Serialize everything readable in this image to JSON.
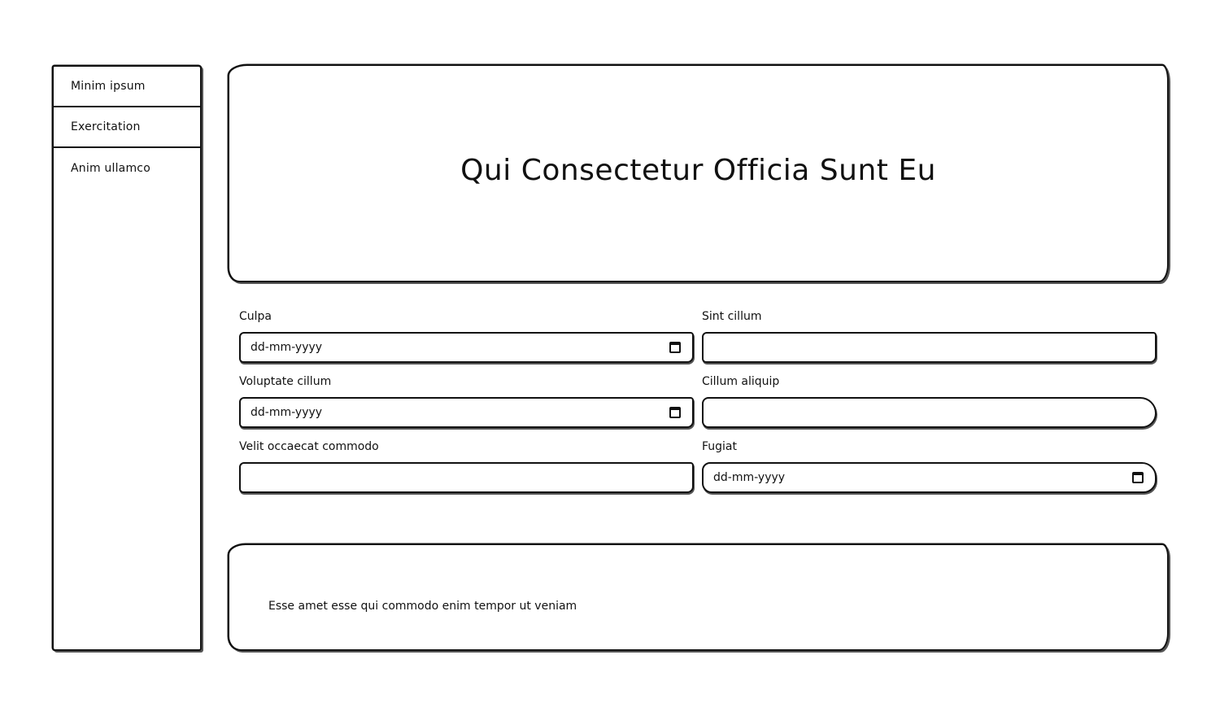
{
  "sidebar": {
    "items": [
      {
        "label": "Minim ipsum"
      },
      {
        "label": "Exercitation"
      },
      {
        "label": "Anim ullamco"
      }
    ]
  },
  "header": {
    "title": "Qui Consectetur Officia Sunt Eu"
  },
  "form": {
    "fields": [
      {
        "label": "Culpa",
        "type": "date",
        "value": "dd-mm-yyyy"
      },
      {
        "label": "Sint cillum",
        "type": "text",
        "value": ""
      },
      {
        "label": "Voluptate cillum",
        "type": "date",
        "value": "dd-mm-yyyy"
      },
      {
        "label": "Cillum aliquip",
        "type": "text",
        "value": ""
      },
      {
        "label": "Velit occaecat commodo",
        "type": "text",
        "value": ""
      },
      {
        "label": "Fugiat",
        "type": "date",
        "value": "dd-mm-yyyy"
      }
    ]
  },
  "footer": {
    "text": "Esse amet esse qui commodo enim tempor ut veniam"
  },
  "icons": {
    "calendar": "calendar-icon"
  },
  "colors": {
    "border": "#111111",
    "background": "#ffffff"
  }
}
